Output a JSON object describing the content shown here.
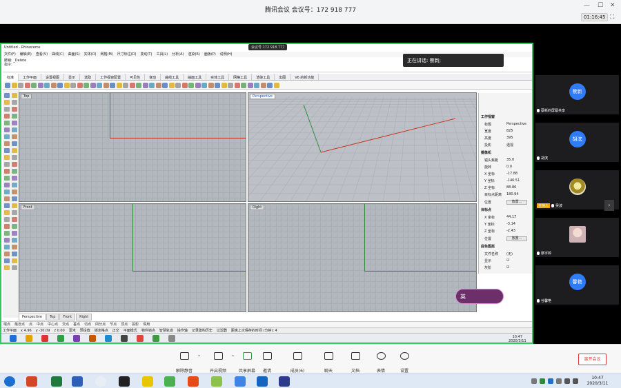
{
  "meeting": {
    "title": "腾讯会议 会议号：172 918 777",
    "timer": "01:16:45",
    "speaking": "正在讲话: 蔡新;",
    "share_label": "会议号 172 918 777",
    "leave": "离开会议"
  },
  "rhino": {
    "title": "Untitled - Rhinoceros",
    "menu": [
      "文件(F)",
      "编辑(E)",
      "查看(V)",
      "曲线(C)",
      "曲面(S)",
      "实体(O)",
      "网格(M)",
      "尺寸标注(D)",
      "变动(T)",
      "工具(L)",
      "分析(A)",
      "渲染(R)",
      "面板(P)",
      "说明(H)"
    ],
    "cmd_lines": [
      "撤销: _Delete",
      "指令: "
    ],
    "tabs": [
      "标准",
      "工作平面",
      "设置视图",
      "显示",
      "选取",
      "工作视窗配置",
      "可见性",
      "变动",
      "曲线工具",
      "曲面工具",
      "实体工具",
      "网格工具",
      "渲染工具",
      "出图",
      "V6 的新功能"
    ],
    "viewports": {
      "top": "Top",
      "perspective": "Perspective",
      "front": "Front",
      "right": "Right"
    },
    "viewport_tabs": [
      "Perspective",
      "Top",
      "Front",
      "Right"
    ],
    "panel": {
      "section_viewport": "工作视窗",
      "title_label": "标题",
      "title_value": "Perspective",
      "width_label": "宽度",
      "width_value": "825",
      "height_label": "高度",
      "height_value": "395",
      "projection_label": "投影",
      "projection_value": "透视",
      "section_camera": "摄像机",
      "lens_label": "镜头焦距",
      "lens_value": "35.0",
      "rotate_label": "旋转",
      "rotate_value": "0.0",
      "cx_label": "X 坐标",
      "cx_value": "-17.88",
      "cy_label": "Y 坐标",
      "cy_value": "-146.51",
      "cz_label": "Z 坐标",
      "cz_value": "88.86",
      "dist_label": "目标点距离",
      "dist_value": "180.94",
      "pos_label": "位置",
      "place_btn": "放置...",
      "section_target": "目标点",
      "tx_label": "X 坐标",
      "tx_value": "44.17",
      "ty_label": "Y 坐标",
      "ty_value": "-3.14",
      "tz_label": "Z 坐标",
      "tz_value": "-2.43",
      "tpos_label": "位置",
      "tplace_btn": "放置...",
      "section_bg": "底色图案",
      "file_label": "文件名称",
      "file_value": "(无)",
      "show_label": "显示",
      "gray_label": "灰阶"
    },
    "osnap": [
      "端点",
      "最近点",
      "点",
      "中点",
      "中心点",
      "交点",
      "垂点",
      "切点",
      "四分点",
      "节点",
      "顶点",
      "投影",
      "停用"
    ],
    "status": [
      "工作平面",
      "x 4.96",
      "y -30.09",
      "z 0.00",
      "毫米",
      "预设值",
      "锁定格点",
      "正交",
      "平面模式",
      "物件锁点",
      "智慧轨迹",
      "操作轴",
      "记录建构历史",
      "过滤器",
      "距离上次保存的时间 (分钟): 4"
    ],
    "inner_clock_time": "10:47",
    "inner_clock_date": "2020/3/11",
    "video_name": "英"
  },
  "participants": [
    {
      "name": "蔡新的屏幕共享",
      "avatar": "蔡新",
      "host": false
    },
    {
      "name": "胡滨",
      "avatar": "胡滨",
      "host": false
    },
    {
      "name": "吴波",
      "avatar": "",
      "host": true,
      "host_label": "主持人"
    },
    {
      "name": "蔡宇婷",
      "avatar": "",
      "host": false
    },
    {
      "name": "谷馨艳",
      "avatar": "馨艳",
      "host": false
    }
  ],
  "toolbar": [
    {
      "label": "解除静音",
      "caret": true
    },
    {
      "label": "开启视频",
      "caret": true
    },
    {
      "label": "共享屏幕",
      "caret": false
    },
    {
      "label": "邀请",
      "caret": false
    },
    {
      "label": "成员(6)",
      "caret": false
    },
    {
      "label": "聊天",
      "caret": false
    },
    {
      "label": "文档",
      "caret": false
    },
    {
      "label": "表情",
      "caret": false
    },
    {
      "label": "设置",
      "caret": false
    }
  ],
  "taskbar": {
    "time": "10:47",
    "date": "2020/3/11"
  },
  "colors": {
    "share_border": "#32c95a",
    "accent_blue": "#2f7cf6",
    "leave_red": "#e03a3a",
    "axis_red": "#c0392b",
    "axis_green": "#2e8b3a"
  }
}
